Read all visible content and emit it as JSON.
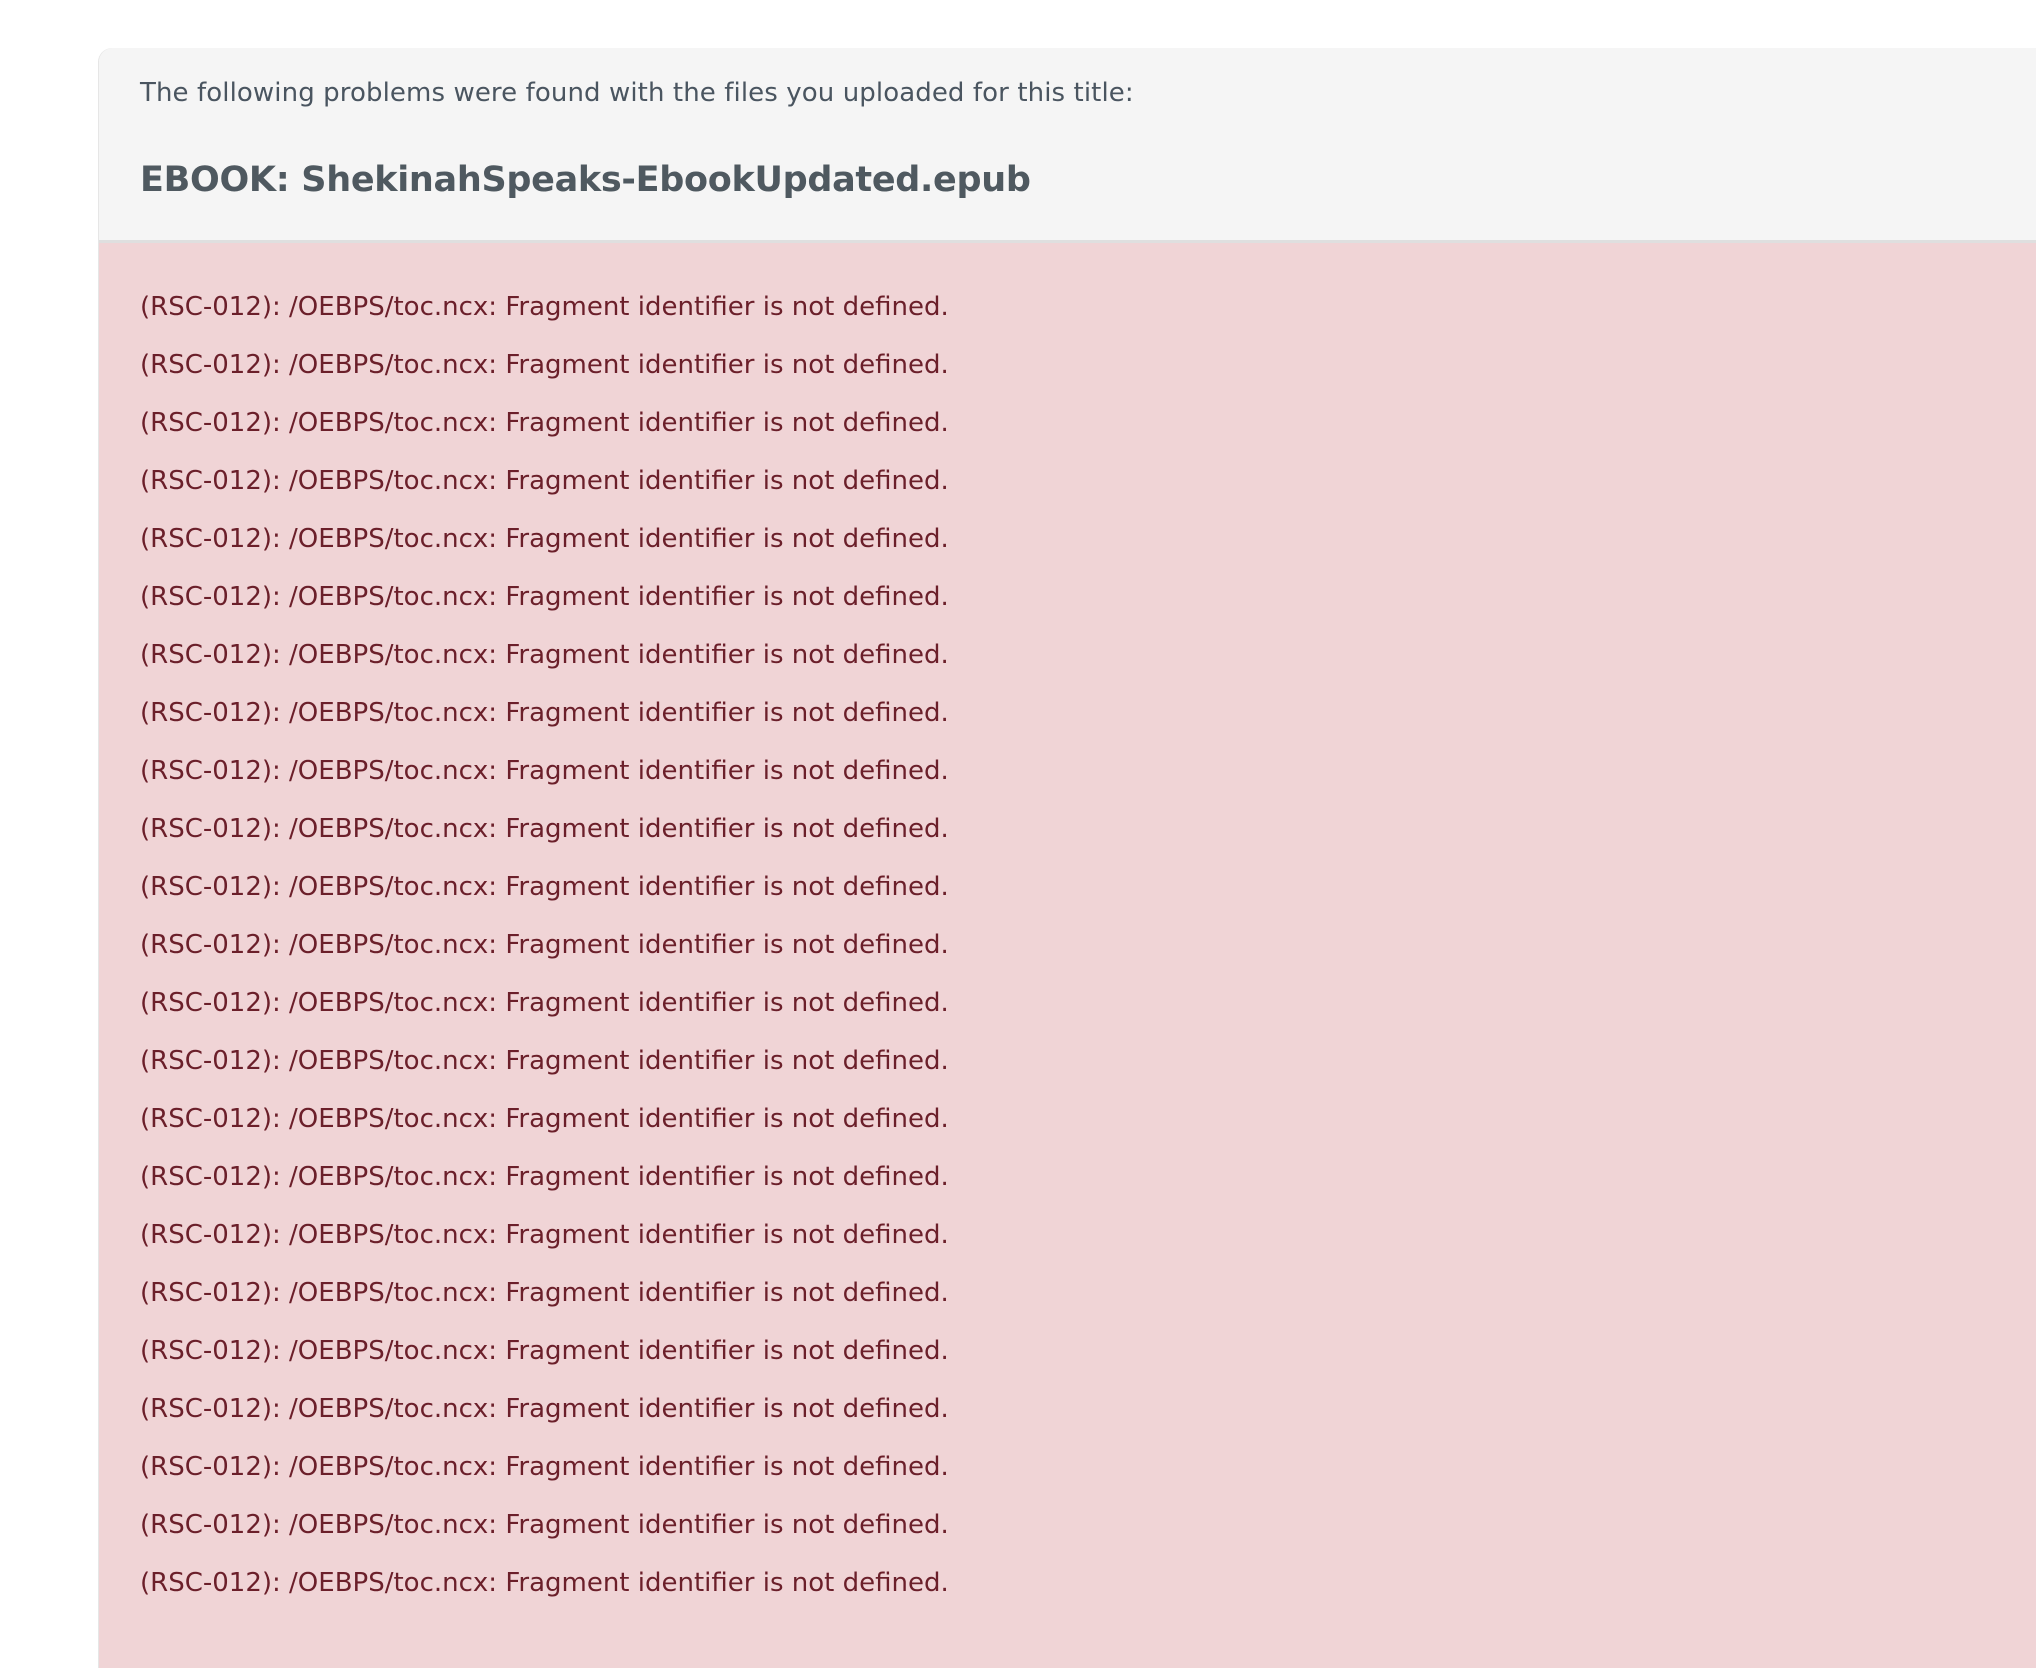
{
  "intro_text": "The following problems were found with the files you uploaded for this title:",
  "file_title": "EBOOK: ShekinahSpeaks-EbookUpdated.epub",
  "errors": [
    "(RSC-012): /OEBPS/toc.ncx: Fragment identifier is not defined.",
    "(RSC-012): /OEBPS/toc.ncx: Fragment identifier is not defined.",
    "(RSC-012): /OEBPS/toc.ncx: Fragment identifier is not defined.",
    "(RSC-012): /OEBPS/toc.ncx: Fragment identifier is not defined.",
    "(RSC-012): /OEBPS/toc.ncx: Fragment identifier is not defined.",
    "(RSC-012): /OEBPS/toc.ncx: Fragment identifier is not defined.",
    "(RSC-012): /OEBPS/toc.ncx: Fragment identifier is not defined.",
    "(RSC-012): /OEBPS/toc.ncx: Fragment identifier is not defined.",
    "(RSC-012): /OEBPS/toc.ncx: Fragment identifier is not defined.",
    "(RSC-012): /OEBPS/toc.ncx: Fragment identifier is not defined.",
    "(RSC-012): /OEBPS/toc.ncx: Fragment identifier is not defined.",
    "(RSC-012): /OEBPS/toc.ncx: Fragment identifier is not defined.",
    "(RSC-012): /OEBPS/toc.ncx: Fragment identifier is not defined.",
    "(RSC-012): /OEBPS/toc.ncx: Fragment identifier is not defined.",
    "(RSC-012): /OEBPS/toc.ncx: Fragment identifier is not defined.",
    "(RSC-012): /OEBPS/toc.ncx: Fragment identifier is not defined.",
    "(RSC-012): /OEBPS/toc.ncx: Fragment identifier is not defined.",
    "(RSC-012): /OEBPS/toc.ncx: Fragment identifier is not defined.",
    "(RSC-012): /OEBPS/toc.ncx: Fragment identifier is not defined.",
    "(RSC-012): /OEBPS/toc.ncx: Fragment identifier is not defined.",
    "(RSC-012): /OEBPS/toc.ncx: Fragment identifier is not defined.",
    "(RSC-012): /OEBPS/toc.ncx: Fragment identifier is not defined.",
    "(RSC-012): /OEBPS/toc.ncx: Fragment identifier is not defined."
  ],
  "colors": {
    "header_bg": "#f5f5f5",
    "error_bg": "#f0d4d6",
    "error_text": "#6b1f2a",
    "heading_text": "#4f5960"
  }
}
